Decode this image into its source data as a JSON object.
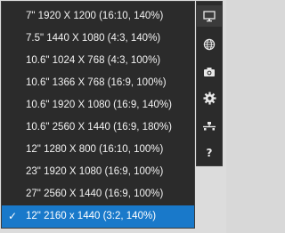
{
  "resolution_menu": {
    "items": [
      {
        "label": "7\" 1920 X 1200 (16:10, 140%)",
        "checked": false
      },
      {
        "label": "7.5\" 1440 X 1080 (4:3, 140%)",
        "checked": false
      },
      {
        "label": "10.6\" 1024 X 768 (4:3, 100%)",
        "checked": false
      },
      {
        "label": "10.6\" 1366 X 768 (16:9, 100%)",
        "checked": false
      },
      {
        "label": "10.6\" 1920 X 1080 (16:9, 140%)",
        "checked": false
      },
      {
        "label": "10.6\" 2560 X 1440 (16:9, 180%)",
        "checked": false
      },
      {
        "label": "12\" 1280 X 800 (16:10, 100%)",
        "checked": false
      },
      {
        "label": "23\" 1920 X 1080 (16:9, 100%)",
        "checked": false
      },
      {
        "label": "27\" 2560 X 1440 (16:9, 100%)",
        "checked": false
      },
      {
        "label": "12\" 2160 x 1440 (3:2, 140%)",
        "checked": true
      }
    ],
    "check_glyph": "✓",
    "selected_color": "#1979ca"
  },
  "toolbar": {
    "buttons": [
      {
        "icon": "monitor-icon"
      },
      {
        "icon": "globe-icon"
      },
      {
        "icon": "camera-icon"
      },
      {
        "icon": "gear-icon"
      },
      {
        "icon": "network-icon"
      },
      {
        "icon": "help-icon",
        "glyph": "?"
      }
    ]
  }
}
